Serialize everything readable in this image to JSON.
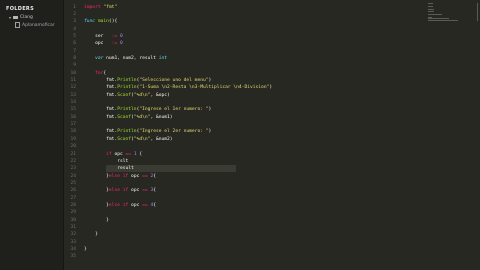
{
  "sidebar": {
    "heading": "FOLDERS",
    "folder": "Clang",
    "file": "Aplanamoficar"
  },
  "editor": {
    "lines": [
      {
        "n": "1",
        "parts": [
          {
            "t": "import ",
            "c": "kw"
          },
          {
            "t": "\"fmt\"",
            "c": "str"
          }
        ]
      },
      {
        "n": "2",
        "parts": []
      },
      {
        "n": "3",
        "parts": [
          {
            "t": "func ",
            "c": "ty"
          },
          {
            "t": "main",
            "c": "fn"
          },
          {
            "t": "(){",
            "c": "plain"
          }
        ]
      },
      {
        "n": "4",
        "parts": []
      },
      {
        "n": "5",
        "parts": [
          {
            "t": "    ser   ",
            "c": "plain"
          },
          {
            "t": ":= ",
            "c": "kw"
          },
          {
            "t": "0",
            "c": "num"
          }
        ]
      },
      {
        "n": "6",
        "parts": [
          {
            "t": "    opc   ",
            "c": "plain"
          },
          {
            "t": ":= ",
            "c": "kw"
          },
          {
            "t": "0",
            "c": "num"
          }
        ]
      },
      {
        "n": "7",
        "parts": []
      },
      {
        "n": "8",
        "parts": [
          {
            "t": "    var ",
            "c": "ty"
          },
          {
            "t": "num1, num2, result ",
            "c": "plain"
          },
          {
            "t": "int",
            "c": "ty"
          }
        ]
      },
      {
        "n": "9",
        "parts": []
      },
      {
        "n": "10",
        "parts": [
          {
            "t": "    for",
            "c": "kw"
          },
          {
            "t": "{",
            "c": "plain"
          }
        ]
      },
      {
        "n": "11",
        "parts": [
          {
            "t": "        fmt.",
            "c": "plain"
          },
          {
            "t": "Println",
            "c": "fn"
          },
          {
            "t": "(",
            "c": "plain"
          },
          {
            "t": "\"Seleccione uno del menu\"",
            "c": "str"
          },
          {
            "t": ")",
            "c": "plain"
          }
        ]
      },
      {
        "n": "12",
        "parts": [
          {
            "t": "        fmt.",
            "c": "plain"
          },
          {
            "t": "Println",
            "c": "fn"
          },
          {
            "t": "(",
            "c": "plain"
          },
          {
            "t": "\"1-Suma \\n2-Resta \\n3-Multiplicar \\n4-Division\"",
            "c": "str"
          },
          {
            "t": ")",
            "c": "plain"
          }
        ]
      },
      {
        "n": "13",
        "parts": [
          {
            "t": "        fmt.",
            "c": "plain"
          },
          {
            "t": "Scanf",
            "c": "fn"
          },
          {
            "t": "(",
            "c": "plain"
          },
          {
            "t": "\"%d\\n\"",
            "c": "str"
          },
          {
            "t": ", &opc)",
            "c": "plain"
          }
        ]
      },
      {
        "n": "14",
        "parts": []
      },
      {
        "n": "15",
        "parts": [
          {
            "t": "        fmt.",
            "c": "plain"
          },
          {
            "t": "Println",
            "c": "fn"
          },
          {
            "t": "(",
            "c": "plain"
          },
          {
            "t": "\"Ingrese el 1er numero: \"",
            "c": "str"
          },
          {
            "t": ")",
            "c": "plain"
          }
        ]
      },
      {
        "n": "16",
        "parts": [
          {
            "t": "        fmt.",
            "c": "plain"
          },
          {
            "t": "Scanf",
            "c": "fn"
          },
          {
            "t": "(",
            "c": "plain"
          },
          {
            "t": "\"%d\\n\"",
            "c": "str"
          },
          {
            "t": ", &num1)",
            "c": "plain"
          }
        ]
      },
      {
        "n": "17",
        "parts": []
      },
      {
        "n": "18",
        "parts": [
          {
            "t": "        fmt.",
            "c": "plain"
          },
          {
            "t": "Println",
            "c": "fn"
          },
          {
            "t": "(",
            "c": "plain"
          },
          {
            "t": "\"Ingrese el 2er numero: \"",
            "c": "str"
          },
          {
            "t": ")",
            "c": "plain"
          }
        ]
      },
      {
        "n": "19",
        "parts": [
          {
            "t": "        fmt.",
            "c": "plain"
          },
          {
            "t": "Scanf",
            "c": "fn"
          },
          {
            "t": "(",
            "c": "plain"
          },
          {
            "t": "\"%d\\n\"",
            "c": "str"
          },
          {
            "t": ", &num2)",
            "c": "plain"
          }
        ]
      },
      {
        "n": "20",
        "parts": []
      },
      {
        "n": "21",
        "parts": [
          {
            "t": "        if ",
            "c": "kw"
          },
          {
            "t": "opc ",
            "c": "plain"
          },
          {
            "t": "== ",
            "c": "kw"
          },
          {
            "t": "1",
            "c": "num"
          },
          {
            "t": " {",
            "c": "plain"
          }
        ]
      },
      {
        "n": "22",
        "parts": [
          {
            "t": "            rslt",
            "c": "plain"
          }
        ]
      },
      {
        "n": "23",
        "parts": [
          {
            "t": "            result",
            "c": "plain"
          }
        ],
        "active": true
      },
      {
        "n": "24",
        "parts": [
          {
            "t": "        }",
            "c": "plain"
          },
          {
            "t": "else if ",
            "c": "kw"
          },
          {
            "t": "opc ",
            "c": "plain"
          },
          {
            "t": "== ",
            "c": "kw"
          },
          {
            "t": "2",
            "c": "num"
          },
          {
            "t": "{",
            "c": "plain"
          }
        ]
      },
      {
        "n": "25",
        "parts": []
      },
      {
        "n": "26",
        "parts": [
          {
            "t": "        }",
            "c": "plain"
          },
          {
            "t": "else if ",
            "c": "kw"
          },
          {
            "t": "opc ",
            "c": "plain"
          },
          {
            "t": "== ",
            "c": "kw"
          },
          {
            "t": "3",
            "c": "num"
          },
          {
            "t": "{",
            "c": "plain"
          }
        ]
      },
      {
        "n": "27",
        "parts": []
      },
      {
        "n": "28",
        "parts": [
          {
            "t": "        }",
            "c": "plain"
          },
          {
            "t": "else if ",
            "c": "kw"
          },
          {
            "t": "opc ",
            "c": "plain"
          },
          {
            "t": "== ",
            "c": "kw"
          },
          {
            "t": "4",
            "c": "num"
          },
          {
            "t": "{",
            "c": "plain"
          }
        ]
      },
      {
        "n": "29",
        "parts": []
      },
      {
        "n": "30",
        "parts": [
          {
            "t": "        }",
            "c": "plain"
          }
        ]
      },
      {
        "n": "31",
        "parts": []
      },
      {
        "n": "32",
        "parts": [
          {
            "t": "    }",
            "c": "plain"
          }
        ]
      },
      {
        "n": "33",
        "parts": []
      },
      {
        "n": "34",
        "parts": [
          {
            "t": "}",
            "c": "plain"
          }
        ]
      },
      {
        "n": "35",
        "parts": []
      }
    ]
  },
  "colors": {
    "background": "#272822",
    "sidebar": "#1f201c",
    "keyword": "#f92672",
    "string": "#e6db74",
    "function": "#a6e22e",
    "number": "#ae81ff",
    "type": "#66d9ef"
  }
}
